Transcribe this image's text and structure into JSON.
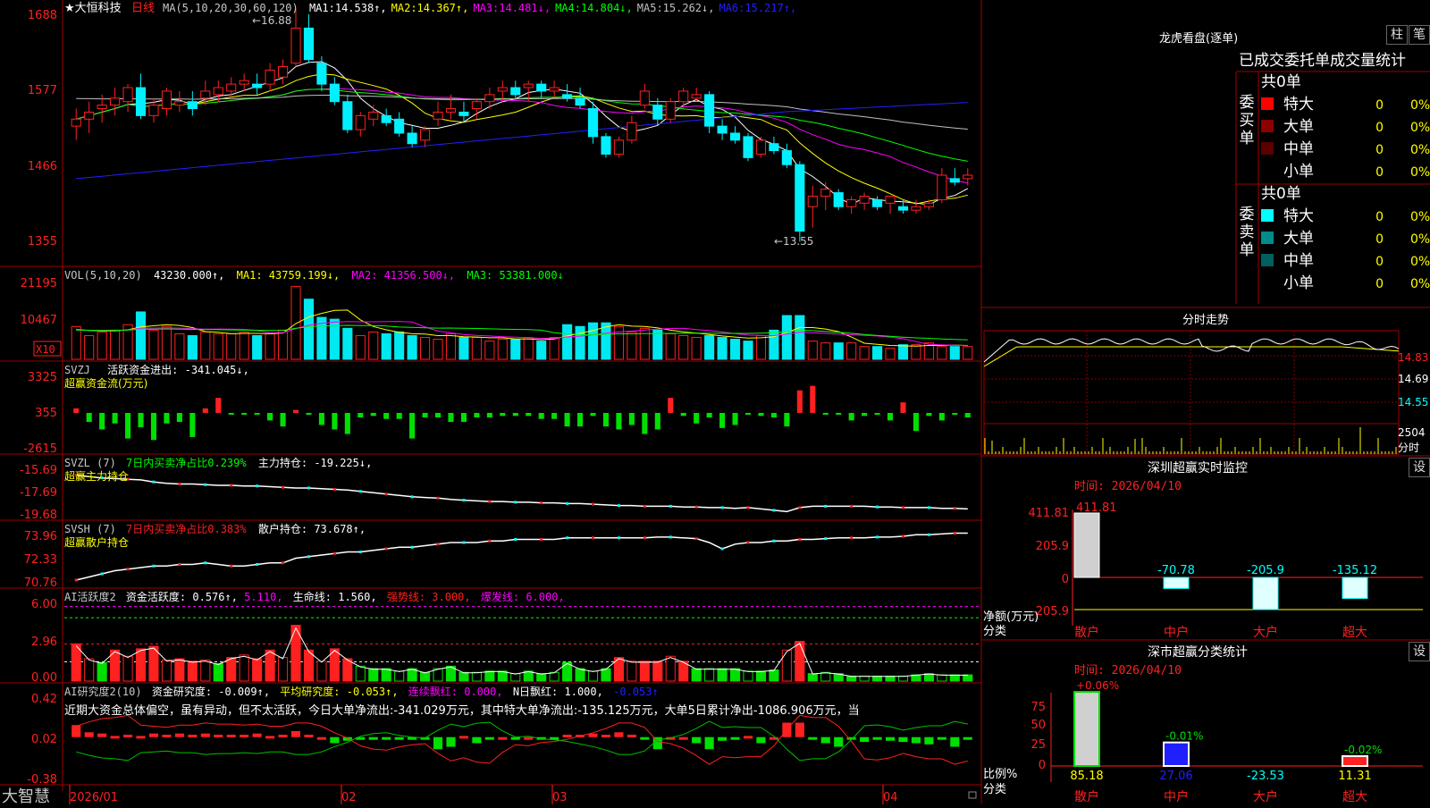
{
  "colors": {
    "up": "#ff2020",
    "down": "#00f0ff",
    "vol_down": "#00e8f0",
    "green": "#00e000",
    "ma5": "#ffffff",
    "ma10": "#ffff00",
    "ma20": "#ff00ff",
    "ma30": "#00ff00",
    "ma60": "#c0c0c0",
    "ma120": "#2020ff",
    "axis": "#ff0000",
    "panel_border": "#a00000"
  },
  "header": {
    "stock": "★大恒科技",
    "period": "日线",
    "ma_params": "MA(5,10,20,30,60,120)",
    "ma_items": [
      {
        "label": "MA1:",
        "value": "14.538",
        "arrow": "↑",
        "color": "#ffffff"
      },
      {
        "label": "MA2:",
        "value": "14.367",
        "arrow": "↑",
        "color": "#ffff00"
      },
      {
        "label": "MA3:",
        "value": "14.481",
        "arrow": "↓",
        "color": "#ff00ff"
      },
      {
        "label": "MA4:",
        "value": "14.804",
        "arrow": "↓",
        "color": "#00ff00"
      },
      {
        "label": "MA5:",
        "value": "15.262",
        "arrow": "↓",
        "color": "#c0c0c0"
      },
      {
        "label": "MA6:",
        "value": "15.217",
        "arrow": "↑",
        "color": "#2020ff"
      }
    ]
  },
  "price_axis": [
    "1688",
    "1577",
    "1466",
    "1355"
  ],
  "price_annotations": {
    "high": "←16.88",
    "low": "←13.55"
  },
  "vol_header": {
    "params": "VOL(5,10,20)",
    "value": "43230.000↑,",
    "items": [
      {
        "label": "MA1:",
        "value": "43759.199↓,",
        "color": "#ffff00"
      },
      {
        "label": "MA2:",
        "value": "41356.500↓,",
        "color": "#ff00ff"
      },
      {
        "label": "MA3:",
        "value": "53381.000↓",
        "color": "#00ff00"
      }
    ]
  },
  "vol_axis": [
    "21195",
    "10467"
  ],
  "vol_unit": "X10",
  "svzj": {
    "title": "SVZJ",
    "label": "活跃资金进出:",
    "value": "-341.045↓,",
    "sub": "超赢资金流(万元)",
    "axis": [
      "3325",
      "355",
      "-2615"
    ]
  },
  "svzl": {
    "title": "SVZL (7)",
    "ratio_label": "7日内买卖净占比0.239%",
    "label": "主力持仓:",
    "value": "-19.225↓,",
    "sub": "超赢主力持仓",
    "axis": [
      "-15.69",
      "-17.69",
      "-19.68"
    ]
  },
  "svsh": {
    "title": "SVSH (7)",
    "ratio_label": "7日内买卖净占比0.383%",
    "label": "散户持仓:",
    "value": "73.678↑,",
    "sub": "超赢散户持仓",
    "axis": [
      "73.96",
      "72.33",
      "70.76"
    ]
  },
  "ai1": {
    "title": "AI活跃度2",
    "items": [
      {
        "text": "资金活跃度: 0.576↑,",
        "color": "#ffffff"
      },
      {
        "text": "5.110,",
        "color": "#ff00ff"
      },
      {
        "text": "生命线: 1.560,",
        "color": "#ffffff"
      },
      {
        "text": "强势线: 3.000,",
        "color": "#ff2020"
      },
      {
        "text": "爆发线: 6.000,",
        "color": "#ff00ff"
      }
    ],
    "axis": [
      "6.00",
      "2.96",
      "0.00"
    ]
  },
  "ai2": {
    "title": "AI研究度2(10)",
    "items": [
      {
        "text": "资金研究度: -0.009↑,",
        "color": "#ffffff"
      },
      {
        "text": "平均研究度: -0.053↑,",
        "color": "#ffff00"
      },
      {
        "text": "连续飘红: 0.000,",
        "color": "#ff00ff"
      },
      {
        "text": "N日飘红: 1.000,",
        "color": "#ffffff"
      },
      {
        "text": "-0.053↑",
        "color": "#2020ff"
      }
    ],
    "desc": "近期大资金总体偏空，虽有异动，但不太活跃，今日大单净流出:-341.029万元，其中特大单净流出:-135.125万元，大单5日累计净出-1086.906万元，当",
    "axis": [
      "0.42",
      "0.02",
      "-0.38"
    ]
  },
  "date_axis": {
    "labels": [
      "2026/01",
      "02",
      "03",
      "04"
    ]
  },
  "logo": "大智慧",
  "right": {
    "lhb_title": "龙虎看盘(逐单)",
    "btn1": "柱",
    "btn2": "笔",
    "stat_title": "已成交委托单成交量统计",
    "buy": {
      "side": "委买单",
      "total": "共0单",
      "rows": [
        {
          "name": "特大",
          "v": "0",
          "p": "0%",
          "c": "#ff0000"
        },
        {
          "name": "大单",
          "v": "0",
          "p": "0%",
          "c": "#8b0000"
        },
        {
          "name": "中单",
          "v": "0",
          "p": "0%",
          "c": "#5a0000"
        },
        {
          "name": "小单",
          "v": "0",
          "p": "0%",
          "c": ""
        }
      ]
    },
    "sell": {
      "side": "委卖单",
      "total": "共0单",
      "rows": [
        {
          "name": "特大",
          "v": "0",
          "p": "0%",
          "c": "#00ffff"
        },
        {
          "name": "大单",
          "v": "0",
          "p": "0%",
          "c": "#008b8b"
        },
        {
          "name": "中单",
          "v": "0",
          "p": "0%",
          "c": "#006060"
        },
        {
          "name": "小单",
          "v": "0",
          "p": "0%",
          "c": ""
        }
      ]
    },
    "fenshi_title": "分时走势",
    "fenshi_axis": [
      "14.83",
      "14.69",
      "14.55"
    ],
    "fenshi_vol": [
      "2504",
      "分时"
    ],
    "sz_title": "深圳超赢实时监控",
    "sz_time": "时间: 2026/04/10",
    "sz_axis": [
      "411.81",
      "205.9",
      "0",
      "-205.9"
    ],
    "sz_unit": "净额(万元)",
    "sz_unit2": "分类",
    "sz_bars": [
      {
        "label": "411.81",
        "value": 411.81
      },
      {
        "label": "-70.78",
        "value": -70.78
      },
      {
        "label": "-205.9",
        "value": -205.9
      },
      {
        "label": "-135.12",
        "value": -135.12
      }
    ],
    "cats": [
      "散户",
      "中户",
      "大户",
      "超大"
    ],
    "set": "设",
    "fl_title": "深市超赢分类统计",
    "fl_time": "时间: 2026/04/10",
    "fl_axis": [
      "75",
      "50",
      "25",
      "0"
    ],
    "fl_unit": "比例%",
    "fl_unit2": "分类",
    "fl_tops": [
      "+0.06%",
      "-0.01%",
      "",
      "-0.02%"
    ],
    "fl_vals": [
      "85.18",
      "27.06",
      "-23.53",
      "11.31"
    ]
  },
  "chart_data": [
    {
      "type": "candlestick",
      "title": "大恒科技 日线",
      "ylim": [
        13.3,
        16.95
      ],
      "ohlc": [
        [
          15.2,
          15.45,
          15.0,
          15.3
        ],
        [
          15.3,
          15.55,
          15.1,
          15.4
        ],
        [
          15.45,
          15.65,
          15.25,
          15.5
        ],
        [
          15.5,
          15.75,
          15.35,
          15.6
        ],
        [
          15.55,
          15.8,
          15.4,
          15.75
        ],
        [
          15.75,
          15.95,
          15.3,
          15.35
        ],
        [
          15.35,
          15.6,
          15.25,
          15.5
        ],
        [
          15.45,
          15.75,
          15.35,
          15.7
        ],
        [
          15.5,
          15.7,
          15.4,
          15.55
        ],
        [
          15.55,
          15.7,
          15.35,
          15.45
        ],
        [
          15.6,
          15.85,
          15.5,
          15.7
        ],
        [
          15.65,
          15.85,
          15.55,
          15.75
        ],
        [
          15.7,
          15.9,
          15.55,
          15.8
        ],
        [
          15.8,
          15.95,
          15.7,
          15.85
        ],
        [
          15.8,
          15.95,
          15.65,
          15.75
        ],
        [
          15.8,
          16.1,
          15.7,
          16.0
        ],
        [
          15.9,
          16.15,
          15.8,
          16.05
        ],
        [
          16.1,
          16.88,
          16.05,
          16.6
        ],
        [
          16.6,
          16.8,
          16.1,
          16.15
        ],
        [
          16.1,
          16.2,
          15.7,
          15.8
        ],
        [
          15.8,
          15.9,
          15.5,
          15.55
        ],
        [
          15.55,
          15.65,
          15.1,
          15.15
        ],
        [
          15.15,
          15.4,
          15.05,
          15.35
        ],
        [
          15.3,
          15.5,
          15.2,
          15.4
        ],
        [
          15.35,
          15.45,
          15.2,
          15.25
        ],
        [
          15.3,
          15.4,
          15.05,
          15.1
        ],
        [
          15.1,
          15.2,
          14.9,
          14.95
        ],
        [
          15.0,
          15.2,
          14.9,
          15.15
        ],
        [
          15.3,
          15.55,
          15.2,
          15.4
        ],
        [
          15.4,
          15.65,
          15.3,
          15.45
        ],
        [
          15.4,
          15.55,
          15.25,
          15.35
        ],
        [
          15.45,
          15.6,
          15.3,
          15.55
        ],
        [
          15.55,
          15.75,
          15.45,
          15.65
        ],
        [
          15.7,
          15.85,
          15.55,
          15.75
        ],
        [
          15.75,
          15.85,
          15.6,
          15.65
        ],
        [
          15.75,
          15.85,
          15.55,
          15.8
        ],
        [
          15.8,
          15.85,
          15.6,
          15.7
        ],
        [
          15.7,
          15.85,
          15.6,
          15.75
        ],
        [
          15.65,
          15.8,
          15.55,
          15.6
        ],
        [
          15.6,
          15.75,
          15.45,
          15.5
        ],
        [
          15.45,
          15.55,
          14.95,
          15.05
        ],
        [
          15.05,
          15.1,
          14.75,
          14.8
        ],
        [
          14.8,
          15.05,
          14.75,
          15.0
        ],
        [
          15.0,
          15.35,
          14.95,
          15.25
        ],
        [
          15.5,
          15.8,
          15.45,
          15.7
        ],
        [
          15.5,
          15.6,
          15.2,
          15.3
        ],
        [
          15.3,
          15.6,
          15.25,
          15.55
        ],
        [
          15.55,
          15.75,
          15.45,
          15.7
        ],
        [
          15.6,
          15.75,
          15.55,
          15.65
        ],
        [
          15.65,
          15.7,
          15.1,
          15.2
        ],
        [
          15.2,
          15.3,
          15.0,
          15.1
        ],
        [
          15.1,
          15.2,
          14.95,
          15.0
        ],
        [
          15.05,
          15.1,
          14.7,
          14.75
        ],
        [
          14.8,
          15.05,
          14.75,
          15.0
        ],
        [
          14.95,
          15.05,
          14.8,
          14.85
        ],
        [
          14.85,
          14.95,
          14.6,
          14.65
        ],
        [
          14.65,
          14.7,
          13.55,
          13.7
        ],
        [
          14.05,
          14.35,
          13.75,
          14.2
        ],
        [
          14.2,
          14.4,
          14.0,
          14.3
        ],
        [
          14.25,
          14.3,
          14.0,
          14.05
        ],
        [
          14.05,
          14.2,
          13.95,
          14.15
        ],
        [
          14.1,
          14.25,
          14.0,
          14.2
        ],
        [
          14.15,
          14.2,
          14.0,
          14.05
        ],
        [
          14.1,
          14.2,
          13.95,
          14.2
        ],
        [
          14.05,
          14.15,
          13.95,
          14.0
        ],
        [
          14.0,
          14.15,
          13.95,
          14.05
        ],
        [
          14.05,
          14.15,
          14.0,
          14.1
        ],
        [
          14.15,
          14.6,
          14.1,
          14.5
        ],
        [
          14.45,
          14.6,
          14.35,
          14.4
        ],
        [
          14.45,
          14.6,
          14.35,
          14.5
        ]
      ]
    },
    {
      "type": "bar",
      "title": "VOL",
      "ylim": [
        0,
        25000
      ],
      "values": [
        9000,
        6500,
        7500,
        8000,
        9500,
        13000,
        8000,
        9000,
        7000,
        6500,
        7500,
        7000,
        7000,
        7500,
        6500,
        7000,
        8000,
        20000,
        16500,
        11500,
        11000,
        8500,
        6500,
        7500,
        7000,
        7500,
        6500,
        6000,
        5500,
        7000,
        6000,
        6000,
        5000,
        5500,
        5500,
        6000,
        5000,
        6000,
        9500,
        9000,
        10000,
        10000,
        9000,
        7500,
        8500,
        8000,
        7000,
        6500,
        6000,
        6500,
        6000,
        5500,
        5000,
        6500,
        8000,
        12000,
        12000,
        5000,
        4500,
        4500,
        4500,
        3500,
        3500,
        3000,
        4000,
        4000,
        4500,
        3500,
        3500,
        3500
      ]
    },
    {
      "type": "bar",
      "title": "SVZJ",
      "ylim": [
        -2615,
        3325
      ],
      "values": [
        300,
        -600,
        -1100,
        -700,
        -1700,
        -950,
        -1800,
        -700,
        -600,
        -1600,
        300,
        1000,
        -100,
        -100,
        -100,
        -500,
        -900,
        200,
        -100,
        -800,
        -1100,
        -1400,
        -300,
        -200,
        -400,
        -400,
        -1700,
        -300,
        -300,
        -600,
        -600,
        -300,
        -300,
        -200,
        -200,
        -200,
        -400,
        -400,
        -900,
        -900,
        -200,
        -900,
        -1100,
        -800,
        -1400,
        -1100,
        1000,
        -200,
        -700,
        -300,
        -1000,
        -800,
        -100,
        -200,
        -300,
        -900,
        1500,
        1800,
        -100,
        -100,
        -500,
        -200,
        -100,
        -500,
        700,
        -1200,
        -200,
        -500,
        -100,
        -300
      ]
    },
    {
      "type": "line",
      "title": "SVZL",
      "ylim": [
        -19.9,
        -15.4
      ],
      "values": [
        -16.7,
        -16.8,
        -16.9,
        -16.95,
        -17.0,
        -17.05,
        -17.2,
        -17.3,
        -17.35,
        -17.35,
        -17.4,
        -17.45,
        -17.45,
        -17.5,
        -17.5,
        -17.55,
        -17.6,
        -17.65,
        -17.65,
        -17.7,
        -17.75,
        -17.8,
        -17.9,
        -18.0,
        -18.1,
        -18.2,
        -18.3,
        -18.35,
        -18.4,
        -18.5,
        -18.55,
        -18.6,
        -18.65,
        -18.65,
        -18.7,
        -18.7,
        -18.75,
        -18.75,
        -18.8,
        -18.8,
        -18.85,
        -18.9,
        -18.95,
        -18.95,
        -19.0,
        -19.0,
        -19.0,
        -19.05,
        -19.05,
        -19.1,
        -19.1,
        -19.15,
        -19.1,
        -19.2,
        -19.3,
        -19.4,
        -19.1,
        -19.0,
        -19.0,
        -19.0,
        -19.0,
        -19.0,
        -19.05,
        -19.05,
        -19.1,
        -19.1,
        -19.1,
        -19.15,
        -19.15,
        -19.2
      ]
    },
    {
      "type": "line",
      "title": "SVSH",
      "ylim": [
        70.5,
        74.5
      ],
      "values": [
        70.9,
        71.1,
        71.3,
        71.5,
        71.6,
        71.7,
        71.8,
        71.8,
        71.9,
        71.9,
        72.0,
        71.9,
        71.8,
        71.8,
        71.9,
        72.0,
        72.0,
        72.3,
        72.4,
        72.5,
        72.6,
        72.7,
        72.7,
        72.8,
        72.9,
        73.0,
        73.0,
        73.1,
        73.2,
        73.3,
        73.3,
        73.3,
        73.4,
        73.4,
        73.5,
        73.5,
        73.5,
        73.5,
        73.6,
        73.6,
        73.6,
        73.6,
        73.6,
        73.6,
        73.6,
        73.65,
        73.65,
        73.6,
        73.55,
        73.3,
        72.9,
        73.2,
        73.3,
        73.3,
        73.4,
        73.4,
        73.5,
        73.5,
        73.55,
        73.6,
        73.6,
        73.6,
        73.65,
        73.65,
        73.7,
        73.8,
        73.8,
        73.85,
        73.9,
        73.9
      ]
    },
    {
      "type": "bar",
      "title": "AI活跃度2",
      "ylim": [
        0,
        7.2
      ],
      "values": [
        3.0,
        1.8,
        1.5,
        2.5,
        2.0,
        2.6,
        2.8,
        1.7,
        1.8,
        1.6,
        1.7,
        1.4,
        1.9,
        2.1,
        1.8,
        2.5,
        1.9,
        4.5,
        2.5,
        1.6,
        2.6,
        1.8,
        1.2,
        1.0,
        1.0,
        0.8,
        1.0,
        0.7,
        1.0,
        1.2,
        0.7,
        0.7,
        0.8,
        0.8,
        0.6,
        0.8,
        0.6,
        0.7,
        1.5,
        1.0,
        0.8,
        1.0,
        1.9,
        1.6,
        1.6,
        1.6,
        2.0,
        1.6,
        1.0,
        1.0,
        1.0,
        1.0,
        0.8,
        0.8,
        0.9,
        2.5,
        3.2,
        0.6,
        0.7,
        0.6,
        0.4,
        0.4,
        0.4,
        0.4,
        0.4,
        0.5,
        0.6,
        0.5,
        0.5,
        0.5
      ]
    },
    {
      "type": "bar",
      "title": "AI研究度2(10)",
      "ylim": [
        -0.38,
        0.42
      ],
      "values": [
        0.1,
        0.04,
        0.03,
        0.01,
        0.02,
        0.01,
        0.03,
        0.02,
        0.03,
        0.02,
        0.03,
        0.02,
        0.02,
        0.02,
        0.03,
        0.01,
        0.02,
        0.05,
        0.02,
        0.0,
        -0.05,
        -0.03,
        -0.02,
        -0.01,
        -0.01,
        -0.02,
        -0.01,
        -0.01,
        -0.1,
        -0.08,
        0.01,
        -0.05,
        -0.02,
        0.0,
        -0.01,
        0.0,
        -0.02,
        -0.01,
        0.02,
        0.02,
        0.03,
        0.02,
        0.04,
        0.02,
        -0.02,
        -0.1,
        0.0,
        0.0,
        -0.05,
        -0.1,
        -0.03,
        -0.01,
        0.01,
        -0.05,
        0.0,
        0.12,
        0.12,
        -0.01,
        -0.05,
        -0.08,
        -0.02,
        -0.04,
        -0.02,
        -0.03,
        -0.04,
        -0.05,
        -0.06,
        -0.02,
        -0.08,
        -0.01
      ]
    }
  ]
}
